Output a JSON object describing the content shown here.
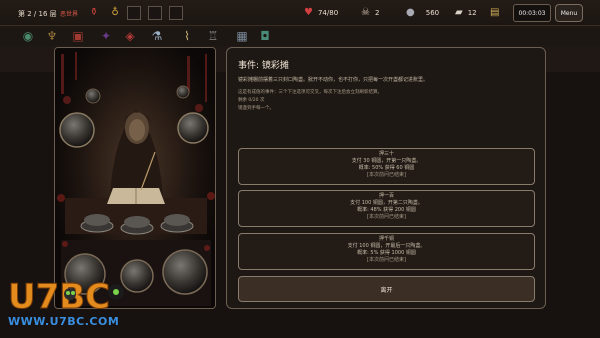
{
  "topbar": {
    "floor": "第 2 / 16 层",
    "zone": "恶世界",
    "hp": "74/80",
    "skull": "2",
    "coin": "560",
    "card": "12",
    "timer": "00:03:03",
    "menu": "Menu"
  },
  "icons": {
    "hp": "heart-icon",
    "skull": "skull-icon",
    "coin": "coin-icon",
    "card": "card-icon",
    "book": "book-icon"
  },
  "event": {
    "title": "事件: 镜彩摊",
    "description": "镜彩摊棚前摆着三只封口陶盏。掀开不动你，也不打你，只把每一次开盏都记进账里。",
    "lines": [
      "这是有成值的事件：三个下注选项可交叉，每次下注后会立刻刷新结算。",
      "剩余 0/20 次",
      "镜盏到手每一个。"
    ],
    "options": [
      {
        "title": "押三十",
        "lines": [
          "支付 30 铜圆，开第一只陶盏。",
          "概率: 50% 获得 60 铜圆",
          "[本次前问已结束]"
        ]
      },
      {
        "title": "押一百",
        "lines": [
          "支付 100 铜圆，开第二只陶盏。",
          "概率: 48% 获得 200 铜圆",
          "[本次前问已结束]"
        ]
      },
      {
        "title": "押千铜",
        "lines": [
          "支付 100 铜圆，开最后一只陶盏。",
          "概率: 5% 获得 1000 铜圆",
          "[本次前问已结束]"
        ]
      }
    ],
    "leave": "离开"
  },
  "watermark": {
    "logo": "U7BC",
    "url": "WWW.U7BC.COM"
  }
}
